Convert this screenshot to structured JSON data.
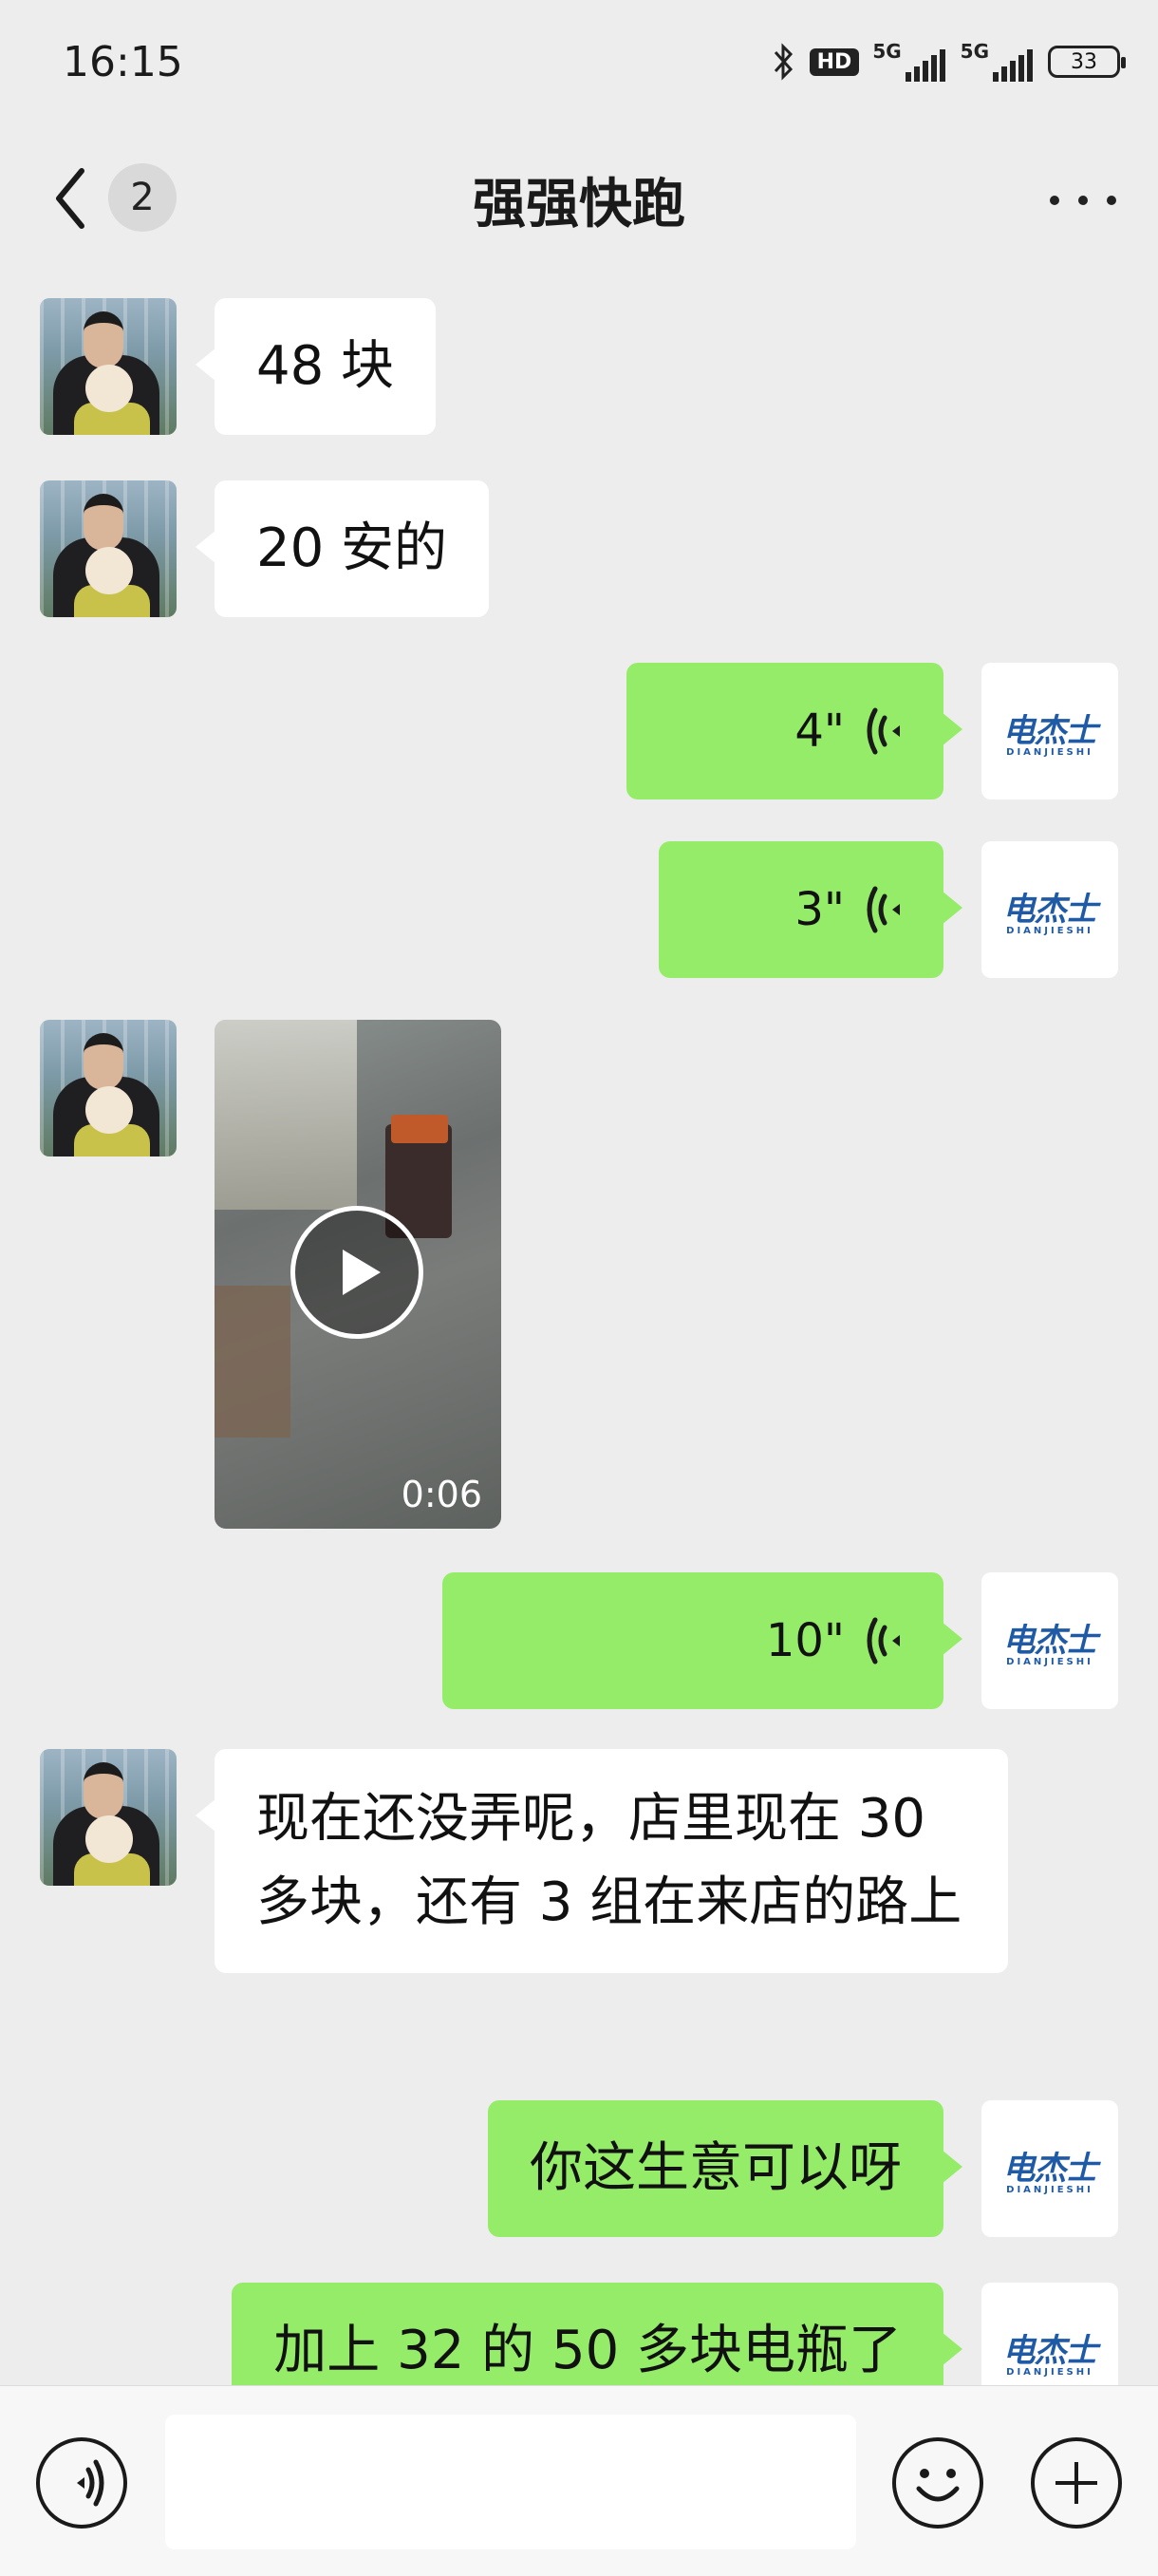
{
  "status_bar": {
    "time": "16:15",
    "hd_label": "HD",
    "network1": "5G",
    "network2": "5G",
    "battery": "33",
    "icons": [
      "bluetooth-icon",
      "hd-voice-icon",
      "signal-icon",
      "signal-icon",
      "battery-icon"
    ]
  },
  "nav": {
    "unread_count": "2",
    "title": "强强快跑",
    "icons": [
      "back-arrow-icon",
      "more-icon"
    ]
  },
  "brand": {
    "main": "电杰士",
    "sub": "DIANJIESHI"
  },
  "messages": [
    {
      "side": "left",
      "type": "text",
      "text": "48 块"
    },
    {
      "side": "left",
      "type": "text",
      "text": "20 安的"
    },
    {
      "side": "right",
      "type": "voice",
      "duration": "4\""
    },
    {
      "side": "right",
      "type": "voice",
      "duration": "3\""
    },
    {
      "side": "left",
      "type": "video",
      "duration": "0:06"
    },
    {
      "side": "right",
      "type": "voice",
      "duration": "10\""
    },
    {
      "side": "left",
      "type": "text",
      "text": "现在还没弄呢，店里现在 30 多块，还有 3 组在来店的路上"
    },
    {
      "side": "right",
      "type": "text",
      "text": "你这生意可以呀"
    },
    {
      "side": "right",
      "type": "text",
      "text": "加上 32 的 50 多块电瓶了"
    }
  ],
  "input_bar": {
    "placeholder": "",
    "icons": [
      "voice-input-icon",
      "emoji-icon",
      "plus-icon"
    ]
  },
  "colors": {
    "background": "#EDEDED",
    "sent_bubble": "#95EC69",
    "received_bubble": "#FFFFFF",
    "input_bar": "#F7F7F7"
  }
}
